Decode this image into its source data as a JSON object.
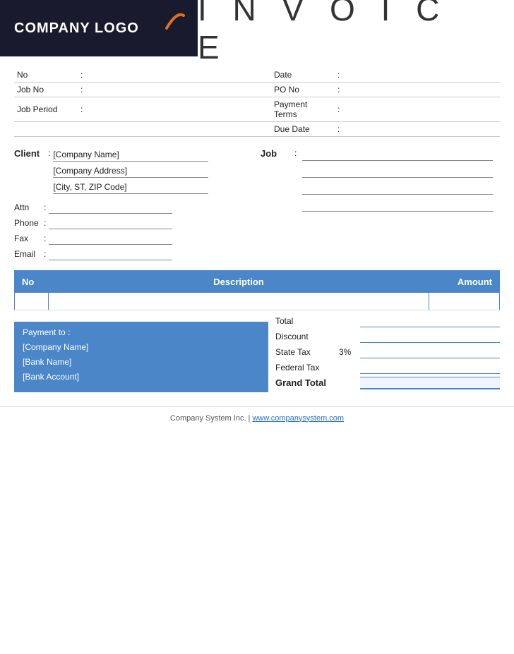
{
  "header": {
    "logo_text": "COMPANY LOGO",
    "invoice_title": "I N V O I C E"
  },
  "meta": {
    "left": [
      {
        "label": "No",
        "colon": ":",
        "value": ""
      },
      {
        "label": "Job No",
        "colon": ":",
        "value": ""
      },
      {
        "label": "Job Period",
        "colon": ":",
        "value": ""
      }
    ],
    "right": [
      {
        "label": "Date",
        "colon": ":",
        "value": ""
      },
      {
        "label": "PO No",
        "colon": ":",
        "value": ""
      },
      {
        "label": "Payment  Terms",
        "colon": ":",
        "value": ""
      },
      {
        "label": "Due Date",
        "colon": ":",
        "value": ""
      }
    ]
  },
  "client": {
    "label": "Client",
    "colon": ":",
    "company_name": "[Company Name]",
    "company_address": "[Company Address]",
    "city_zip": "[City, ST, ZIP Code]",
    "fields": [
      {
        "label": "Attn",
        "colon": ":",
        "value": ""
      },
      {
        "label": "Phone",
        "colon": ":",
        "value": ""
      },
      {
        "label": "Fax",
        "colon": ":",
        "value": ""
      },
      {
        "label": "Email",
        "colon": ":",
        "value": ""
      }
    ]
  },
  "job": {
    "label": "Job",
    "colon": ":",
    "lines": [
      "",
      "",
      "",
      ""
    ]
  },
  "items_table": {
    "col_no": "No",
    "col_description": "Description",
    "col_amount": "Amount"
  },
  "totals": {
    "rows": [
      {
        "label": "Total",
        "percent": "",
        "value": "",
        "bold": false
      },
      {
        "label": "Discount",
        "percent": "",
        "value": "",
        "bold": false
      },
      {
        "label": "State Tax",
        "percent": "3%",
        "value": "",
        "bold": false
      },
      {
        "label": "Federal Tax",
        "percent": "",
        "value": "",
        "bold": false
      },
      {
        "label": "Grand Total",
        "percent": "",
        "value": "",
        "bold": true
      }
    ]
  },
  "payment": {
    "label": "Payment to :",
    "company_name": "[Company Name]",
    "bank_name": "[Bank Name]",
    "bank_account": "[Bank Account]"
  },
  "footer": {
    "text": "Company System Inc. | ",
    "link_text": "www.companysystem.com"
  }
}
